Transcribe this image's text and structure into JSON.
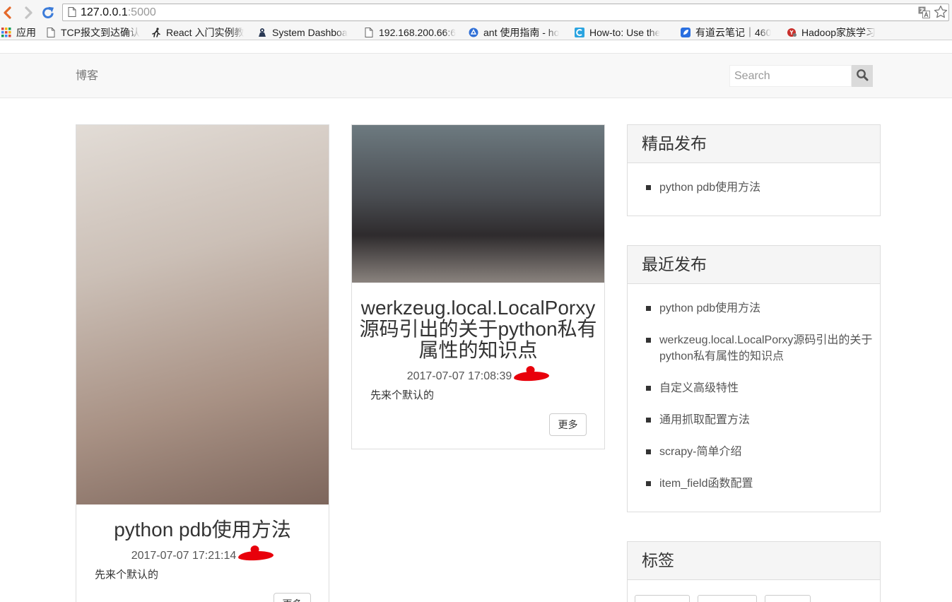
{
  "browser": {
    "back_icon": "back-arrow-icon",
    "forward_icon": "forward-arrow-icon",
    "reload_icon": "reload-icon",
    "page_icon": "page-icon",
    "url_host": "127.0.0.1",
    "url_port": ":5000",
    "translate_icon": "translate-icon",
    "bookmark_star_icon": "star-icon"
  },
  "bookmarks": [
    {
      "icon": "apps-grid-icon",
      "label": "应用"
    },
    {
      "icon": "page-icon",
      "label": "TCP报文到达确认"
    },
    {
      "icon": "runner-icon",
      "label": "React 入门实例教"
    },
    {
      "icon": "dashboard-icon",
      "label": "System Dashboa"
    },
    {
      "icon": "page-icon",
      "label": "192.168.200.66:6"
    },
    {
      "icon": "blue-circle-icon",
      "label": "ant 使用指南 - ho"
    },
    {
      "icon": "c-logo-icon",
      "label": "How-to: Use the"
    },
    {
      "icon": "note-icon",
      "label": "有道云笔记｜460"
    },
    {
      "icon": "red-circle-icon",
      "label": "Hadoop家族学习"
    }
  ],
  "navbar": {
    "brand": "博客",
    "search_placeholder": "Search",
    "search_icon": "search-icon"
  },
  "posts": [
    {
      "title": "python pdb使用方法",
      "date": "2017-07-07 17:21:14",
      "summary": "先来个默认的",
      "more": "更多"
    },
    {
      "title": "werkzeug.local.LocalPorxy源码引出的关于python私有属性的知识点",
      "date": "2017-07-07 17:08:39",
      "summary": "先来个默认的",
      "more": "更多"
    }
  ],
  "sidebar": {
    "featured": {
      "title": "精品发布",
      "items": [
        "python pdb使用方法"
      ]
    },
    "recent": {
      "title": "最近发布",
      "items": [
        "python pdb使用方法",
        "werkzeug.local.LocalPorxy源码引出的关于python私有属性的知识点",
        "自定义高级特性",
        "通用抓取配置方法",
        "scrapy-简单介绍",
        "item_field函数配置"
      ]
    },
    "tags": {
      "title": "标签"
    }
  },
  "colors": {
    "navbar_bg": "#f8f8f8",
    "navbar_border": "#e7e7e7",
    "panel_header_bg": "#f5f5f5",
    "border": "#dddddd",
    "text": "#333333",
    "muted": "#555555",
    "brand": "#777777",
    "redaction": "#e8000b",
    "back_icon": "#e4692a",
    "reload_icon": "#3b7bd9",
    "search_button_bg": "#dadada"
  }
}
